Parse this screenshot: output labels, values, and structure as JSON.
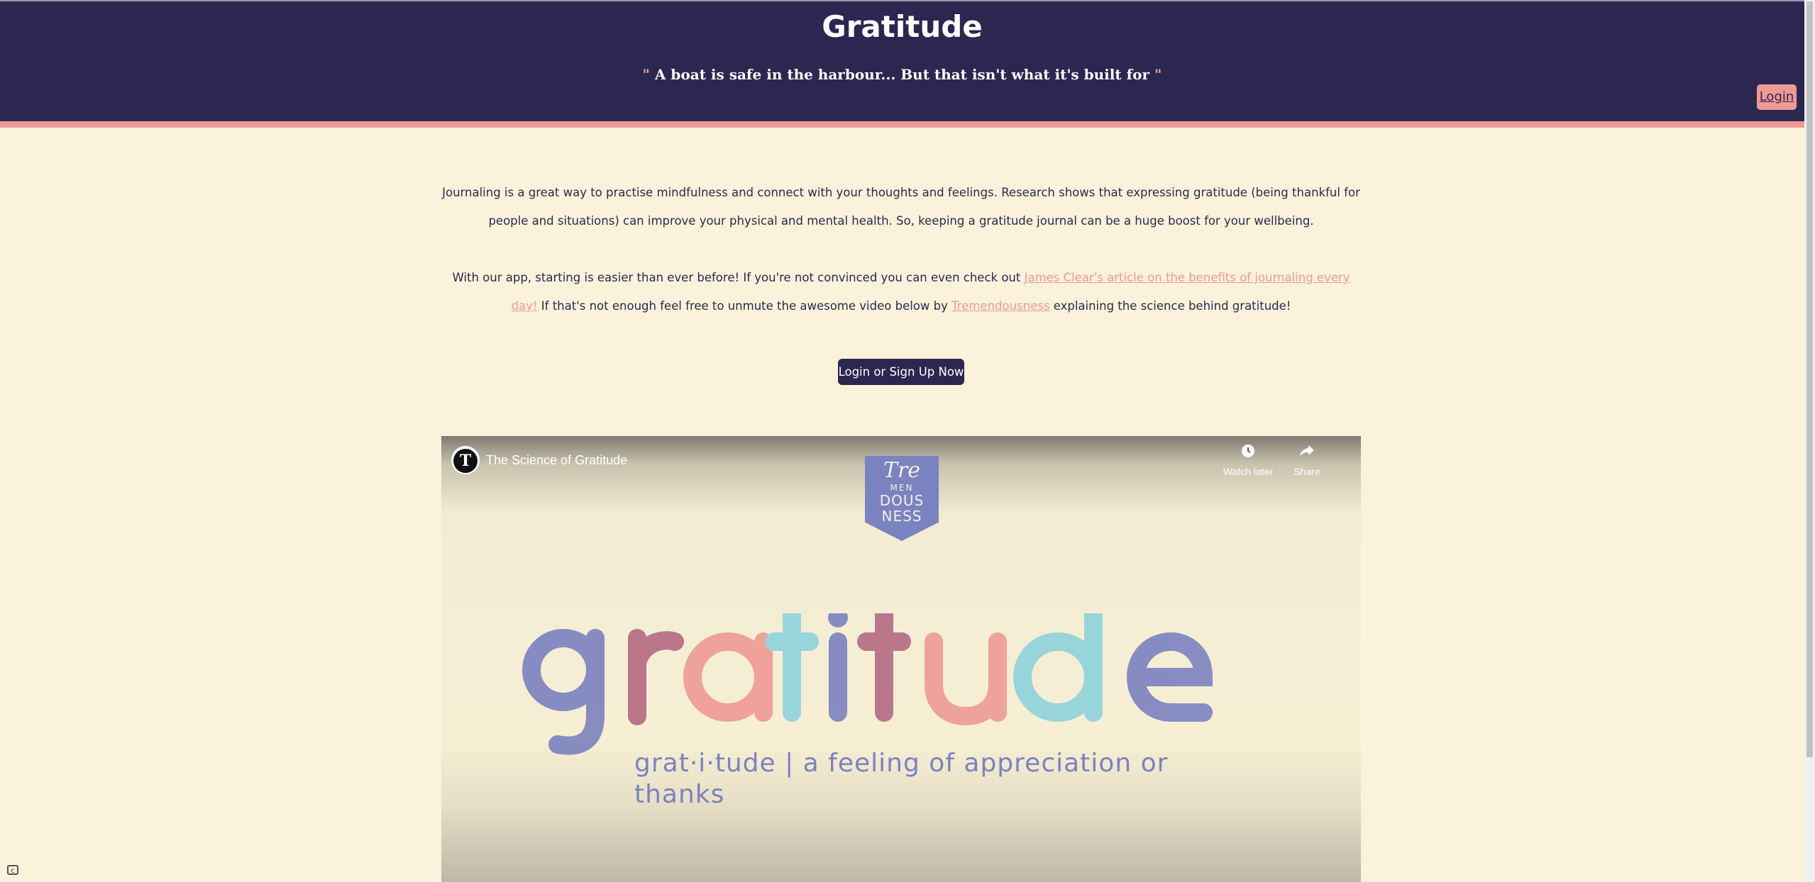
{
  "header": {
    "title": "Gratitude",
    "quote_open": "\"",
    "quote_text": " A boat is safe in the harbour... But that isn't what it's built for ",
    "quote_close": "\"",
    "login_label": "Login"
  },
  "intro": {
    "p1": "Journaling is a great way to practise mindfulness and connect with your thoughts and feelings. Research shows that expressing gratitude (being thankful for people and situations) can improve your physical and mental health. So, keeping a gratitude journal can be a huge boost for your wellbeing.",
    "p2_before": "With our app, starting is easier than ever before! If you're not convinced you can even check out ",
    "p2_link1": "James Clear's article on the benefits of journaling every day!",
    "p2_middle": " If that's not enough feel free to unmute the awesome video below by ",
    "p2_link2": "Tremendousness",
    "p2_after": " explaining the science behind gratitude!"
  },
  "cta_label": "Login or Sign Up Now",
  "video": {
    "channel_initial": "T",
    "title": "The Science of Gratitude",
    "watch_later": "Watch later",
    "share": "Share",
    "crest_l1": "Tre",
    "crest_l2": "MEN",
    "crest_l3": "DOUS",
    "crest_l4": "NESS",
    "big_word": "gratitude",
    "tagline": "grat·i·tude | a feeling of appreciation or thanks"
  },
  "colors": {
    "header_bg": "#2c2750",
    "accent": "#ee9a94",
    "page_bg": "#fbf2dc",
    "letter_blue": "#7b82c0",
    "letter_pink": "#ee9a94",
    "letter_cyan": "#8fd3dc",
    "letter_plum": "#b46a83"
  }
}
